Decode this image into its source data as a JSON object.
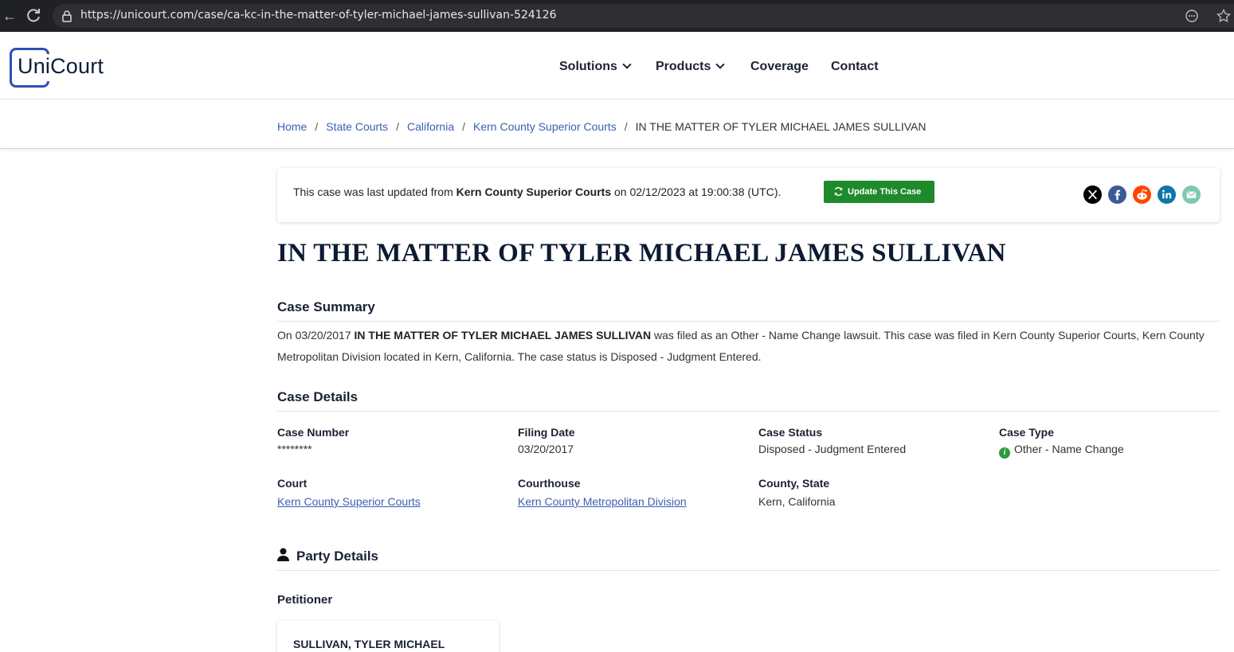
{
  "browser": {
    "url": "https://unicourt.com/case/ca-kc-in-the-matter-of-tyler-michael-james-sullivan-524126"
  },
  "header": {
    "logo_text": "UniCourt",
    "nav": [
      {
        "label": "Solutions",
        "has_dropdown": true
      },
      {
        "label": "Products",
        "has_dropdown": true
      },
      {
        "label": "Coverage",
        "has_dropdown": false
      },
      {
        "label": "Contact",
        "has_dropdown": false
      }
    ]
  },
  "breadcrumb": {
    "items": [
      "Home",
      "State Courts",
      "California",
      "Kern County Superior Courts"
    ],
    "current": "IN THE MATTER OF TYLER MICHAEL JAMES SULLIVAN",
    "separator": "/"
  },
  "update": {
    "prefix": "This case was last updated from ",
    "court": "Kern County Superior Courts",
    "suffix": " on 02/12/2023 at 19:00:38 (UTC).",
    "button_label": "Update This Case",
    "button_color": "#1f8a2b"
  },
  "share": [
    "x-icon",
    "facebook-icon",
    "reddit-icon",
    "linkedin-icon",
    "email-icon"
  ],
  "case": {
    "title": "IN THE MATTER OF TYLER MICHAEL JAMES SULLIVAN"
  },
  "summary": {
    "heading": "Case Summary",
    "part1": "On 03/20/2017 ",
    "bold": "IN THE MATTER OF TYLER MICHAEL JAMES SULLIVAN",
    "part2": " was filed as an Other - Name Change lawsuit. This case was filed in Kern County Superior Courts, Kern County Metropolitan Division located in Kern, California. The case status is Disposed - Judgment Entered."
  },
  "details": {
    "heading": "Case Details",
    "case_number_label": "Case Number",
    "case_number": "********",
    "filing_date_label": "Filing Date",
    "filing_date": "03/20/2017",
    "case_status_label": "Case Status",
    "case_status": "Disposed - Judgment Entered",
    "case_type_label": "Case Type",
    "case_type": "Other - Name Change",
    "court_label": "Court",
    "court": "Kern County Superior Courts",
    "courthouse_label": "Courthouse",
    "courthouse": "Kern County Metropolitan Division",
    "county_state_label": "County, State",
    "county_state": "Kern, California"
  },
  "party": {
    "heading": "Party Details",
    "role": "Petitioner",
    "name": "SULLIVAN, TYLER MICHAEL"
  },
  "colors": {
    "link": "#3a5fb0",
    "brand": "#2f4fb5",
    "accent_green": "#1f8a2b"
  }
}
